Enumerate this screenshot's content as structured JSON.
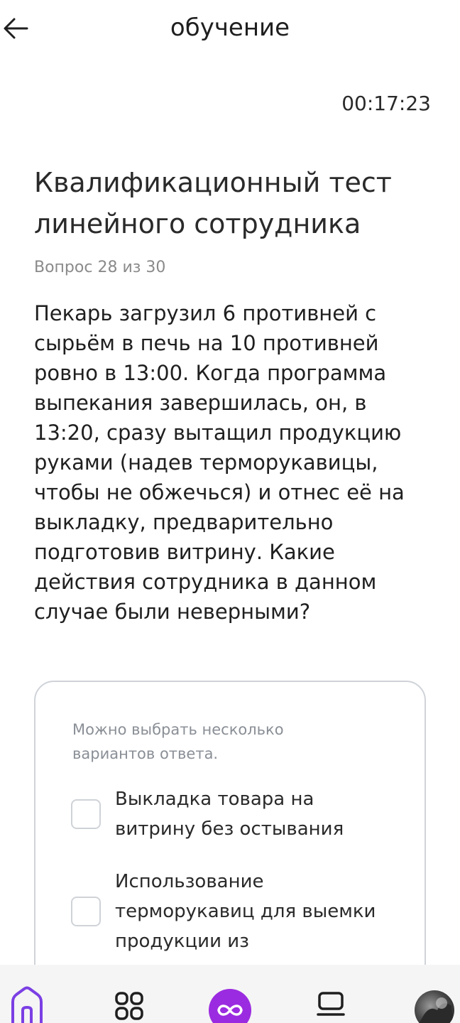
{
  "header": {
    "title": "обучение",
    "back_icon": "arrow-left-icon"
  },
  "timer": "00:17:23",
  "test": {
    "title": "Квалификационный тест линейного сотрудника",
    "counter": "Вопрос 28 из 30",
    "question": "Пекарь загрузил 6 противней с сырьём в печь на 10 противней ровно в 13:00. Когда программа выпекания завершилась, он, в 13:20, сразу вытащил продукцию руками (надев терморукавицы, чтобы не обжечься) и отнес её на выкладку, предварительно подготовив витрину. Какие действия сотрудника в данном случае были неверными?"
  },
  "answers": {
    "hint": "Можно выбрать несколько вариантов ответа.",
    "options": [
      {
        "label": "Выкладка товара на витрину без остывания",
        "checked": false
      },
      {
        "label": "Использование терморукавиц для выемки продукции из",
        "checked": false
      }
    ]
  },
  "bottom_nav": {
    "items": [
      "home-icon",
      "catalog-grid-icon",
      "infinity-center-icon",
      "courses-screen-icon",
      "profile-avatar"
    ]
  },
  "colors": {
    "accent": "#9b2be0",
    "home_active": "#7b3fe4",
    "border": "#cfd3d8",
    "muted": "#8a8a8a"
  }
}
